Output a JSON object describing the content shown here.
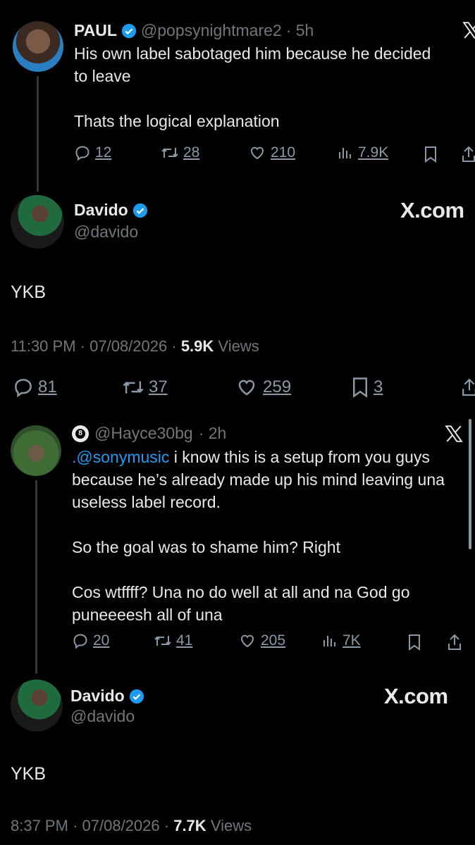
{
  "tweet1": {
    "name": "PAUL",
    "handle": "@popsynightmare2",
    "time": "· 5h",
    "text": "His own label sabotaged him because he decided\nto leave\n\nThats the logical explanation",
    "replies": "12",
    "retweets": "28",
    "likes": "210",
    "views": "7.9K"
  },
  "card1": {
    "name": "Davido",
    "handle": "@davido",
    "brand": "X.com",
    "text": "YKB",
    "time": "11:30 PM",
    "date": "07/08/2026",
    "views_count": "5.9K",
    "views_label": "Views",
    "replies": "81",
    "retweets": "37",
    "likes": "259",
    "bookmarks": "3"
  },
  "tweet2": {
    "name_emoji": "8",
    "handle": "@Hayce30bg",
    "time": "· 2h",
    "mention": ".@sonymusic",
    "text_after_mention": " i know this is a setup from you guys\nbecause he’s already made up his mind leaving una\nuseless label record.\n\nSo the goal was to shame him? Right\n\nCos wtffff? Una no do well at all and na God go\npuneeeesh all of una",
    "replies": "20",
    "retweets": "41",
    "likes": "205",
    "views": "7K"
  },
  "card2": {
    "name": "Davido",
    "handle": "@davido",
    "brand": "X.com",
    "text": "YKB",
    "time": "8:37 PM",
    "date": "07/08/2026",
    "views_count": "7.7K",
    "views_label": "Views"
  },
  "colors": {
    "background": "#000000",
    "text": "#e7e9ea",
    "muted": "#71767b",
    "accent": "#1d9bf0"
  }
}
